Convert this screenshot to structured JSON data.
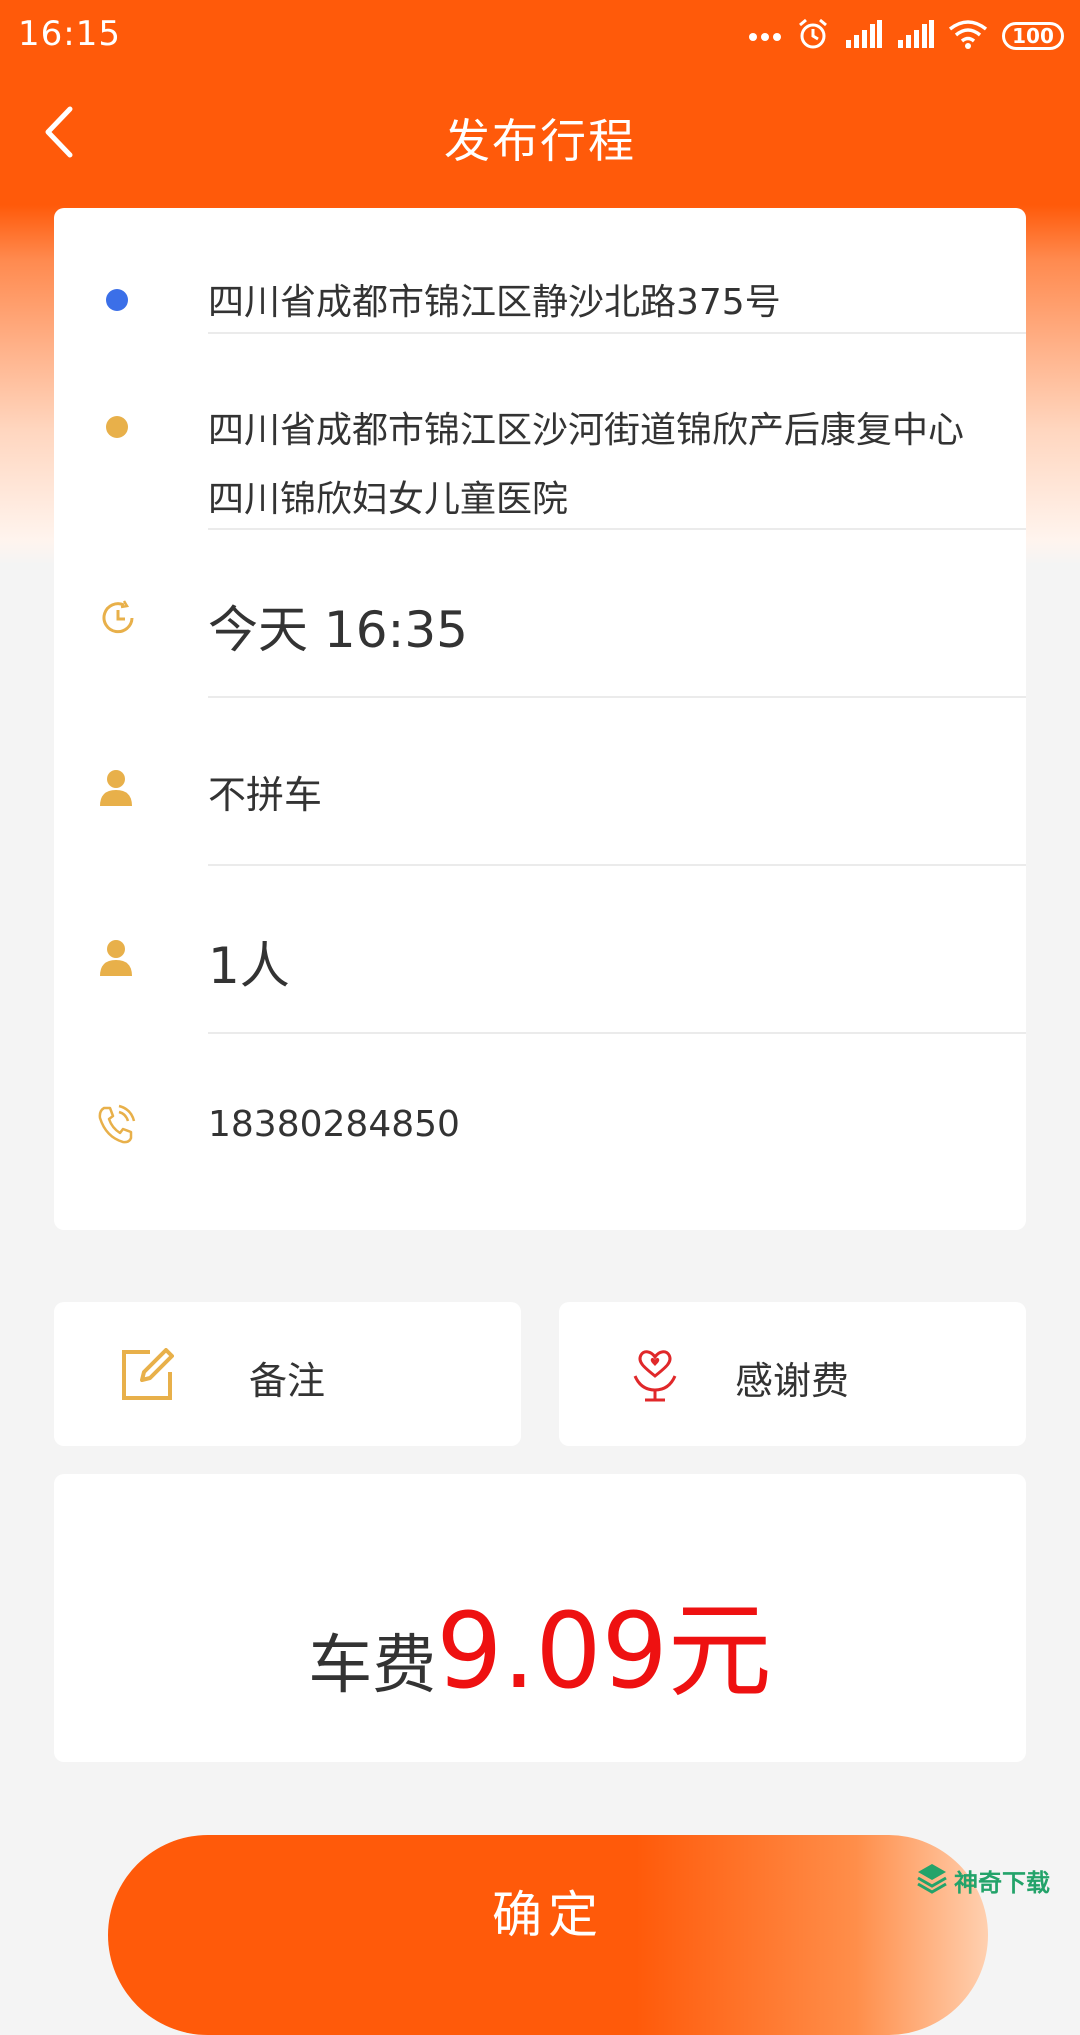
{
  "status_bar": {
    "time": "16:15",
    "battery": "100",
    "icons": [
      "more-dots-icon",
      "alarm-icon",
      "signal-icon",
      "signal-icon",
      "wifi-icon",
      "battery-icon"
    ]
  },
  "header": {
    "title": "发布行程",
    "back_icon": "chevron-left-icon"
  },
  "trip": {
    "start_address": "四川省成都市锦江区静沙北路375号",
    "end_address_line1": "四川省成都市锦江区沙河街道锦欣产后康复中心",
    "end_address_line2": "四川锦欣妇女儿童医院",
    "time": "今天 16:35",
    "carpool": "不拼车",
    "passengers": "1人",
    "phone": "18380284850"
  },
  "options": {
    "remark_label": "备注",
    "thanks_fee_label": "感谢费"
  },
  "fare": {
    "prefix": "车费",
    "amount": "9.09",
    "unit": "元"
  },
  "confirm_label": "确定",
  "watermark": {
    "text": "神奇下载"
  },
  "colors": {
    "brand_orange": "#ff5a0a",
    "start_dot": "#3b6fe8",
    "end_dot": "#e8b04a",
    "icon_gold": "#e8b04a",
    "price_red": "#ee1111",
    "thanks_red": "#e0282a"
  }
}
